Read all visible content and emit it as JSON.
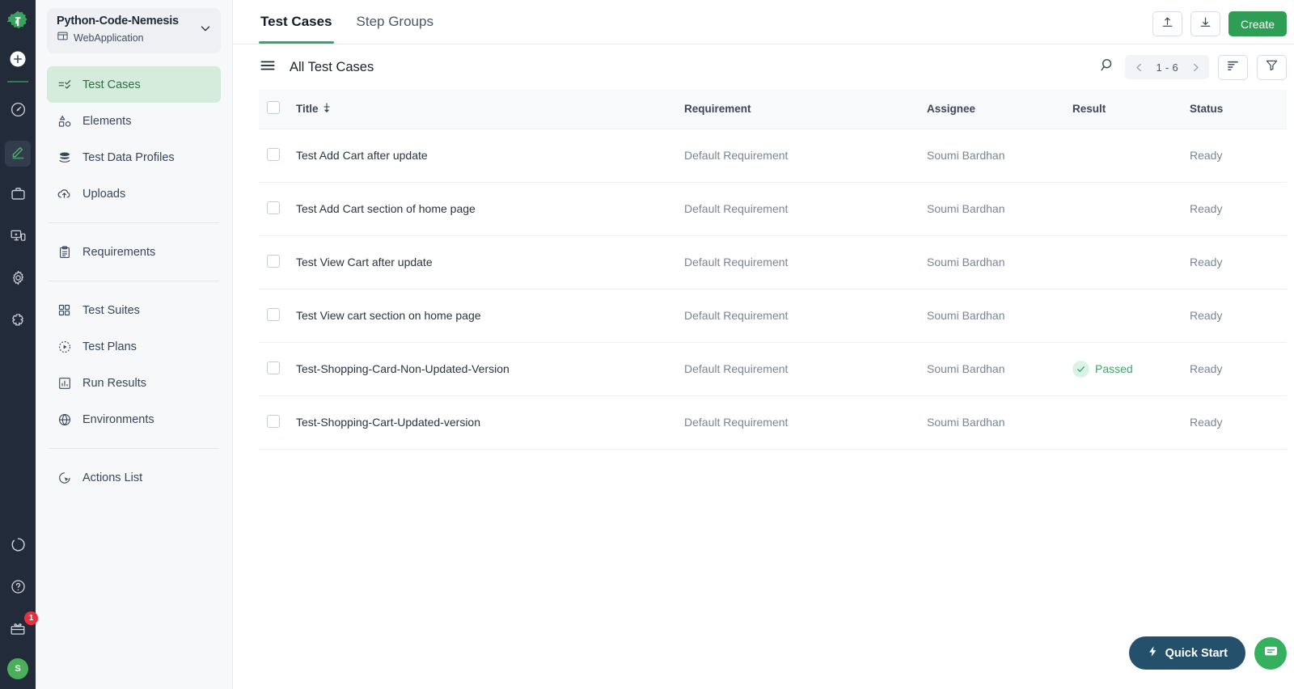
{
  "rail": {
    "logo_icon": "testsigma-gear-logo-icon",
    "add_icon": "plus-circle-icon",
    "items": [
      {
        "name": "dashboard",
        "icon": "speedometer-icon",
        "active": false
      },
      {
        "name": "create-test",
        "icon": "pencil-edit-icon",
        "active": true
      },
      {
        "name": "projects",
        "icon": "briefcase-icon",
        "active": false
      },
      {
        "name": "devices",
        "icon": "devices-icon",
        "active": false
      },
      {
        "name": "settings",
        "icon": "gear-icon",
        "active": false
      },
      {
        "name": "addons",
        "icon": "puzzle-piece-icon",
        "active": false
      }
    ],
    "bottom": [
      {
        "name": "activity",
        "icon": "loading-circle-icon"
      },
      {
        "name": "help",
        "icon": "question-circle-icon"
      },
      {
        "name": "whats-new",
        "icon": "gift-icon",
        "badge": "1"
      }
    ],
    "avatar_initial": "S"
  },
  "sidebar": {
    "project": {
      "name": "Python-Code-Nemesis",
      "type": "WebApplication",
      "type_icon": "window-layout-icon",
      "chevron_icon": "chevron-down-icon"
    },
    "groups": [
      {
        "items": [
          {
            "label": "Test Cases",
            "icon": "test-cases-icon",
            "active": true
          },
          {
            "label": "Elements",
            "icon": "elements-shapes-icon",
            "active": false
          },
          {
            "label": "Test Data Profiles",
            "icon": "database-stack-icon",
            "active": false
          },
          {
            "label": "Uploads",
            "icon": "cloud-upload-icon",
            "active": false
          }
        ]
      },
      {
        "items": [
          {
            "label": "Requirements",
            "icon": "clipboard-icon",
            "active": false
          }
        ]
      },
      {
        "items": [
          {
            "label": "Test Suites",
            "icon": "grid-squares-icon",
            "active": false
          },
          {
            "label": "Test Plans",
            "icon": "play-circle-dashed-icon",
            "active": false
          },
          {
            "label": "Run Results",
            "icon": "bar-chart-icon",
            "active": false
          },
          {
            "label": "Environments",
            "icon": "globe-icon",
            "active": false
          }
        ]
      },
      {
        "items": [
          {
            "label": "Actions List",
            "icon": "cursor-target-icon",
            "active": false
          }
        ]
      }
    ]
  },
  "topbar": {
    "tabs": [
      {
        "label": "Test Cases",
        "active": true
      },
      {
        "label": "Step Groups",
        "active": false
      }
    ],
    "upload_icon": "upload-tray-icon",
    "download_icon": "download-tray-icon",
    "create_label": "Create"
  },
  "toolbar": {
    "menu_icon": "hamburger-menu-icon",
    "title": "All Test Cases",
    "search_icon": "search-icon",
    "prev_icon": "chevron-left-icon",
    "next_icon": "chevron-right-icon",
    "page_label": "1 - 6",
    "sort_icon": "sort-lines-icon",
    "filter_icon": "funnel-filter-icon"
  },
  "table": {
    "columns": [
      {
        "key": "title",
        "label": "Title",
        "sort_icon": "sort-arrows-icon"
      },
      {
        "key": "requirement",
        "label": "Requirement"
      },
      {
        "key": "assignee",
        "label": "Assignee"
      },
      {
        "key": "result",
        "label": "Result"
      },
      {
        "key": "status",
        "label": "Status"
      }
    ],
    "rows": [
      {
        "title": "Test Add Cart after update",
        "requirement": "Default Requirement",
        "assignee": "Soumi Bardhan",
        "result": "",
        "status": "Ready"
      },
      {
        "title": "Test Add Cart section of home page",
        "requirement": "Default Requirement",
        "assignee": "Soumi Bardhan",
        "result": "",
        "status": "Ready"
      },
      {
        "title": "Test View Cart after update",
        "requirement": "Default Requirement",
        "assignee": "Soumi Bardhan",
        "result": "",
        "status": "Ready"
      },
      {
        "title": "Test View cart section on home page",
        "requirement": "Default Requirement",
        "assignee": "Soumi Bardhan",
        "result": "",
        "status": "Ready"
      },
      {
        "title": "Test-Shopping-Card-Non-Updated-Version",
        "requirement": "Default Requirement",
        "assignee": "Soumi Bardhan",
        "result": "Passed",
        "status": "Ready"
      },
      {
        "title": "Test-Shopping-Cart-Updated-version",
        "requirement": "Default Requirement",
        "assignee": "Soumi Bardhan",
        "result": "",
        "status": "Ready"
      }
    ]
  },
  "floating": {
    "quick_start_label": "Quick Start",
    "quick_start_icon": "lightning-bolt-icon",
    "chat_icon": "chat-bubble-icon"
  },
  "colors": {
    "brand_green": "#2e9e55",
    "accent_green": "#3aa864",
    "active_nav_bg": "#d5ecdc",
    "rail_bg": "#222b39",
    "sidebar_bg": "#f7f8fa",
    "badge_red": "#ec2f3c",
    "quick_start_bg": "#24506b",
    "passed_green": "#3ca569"
  }
}
